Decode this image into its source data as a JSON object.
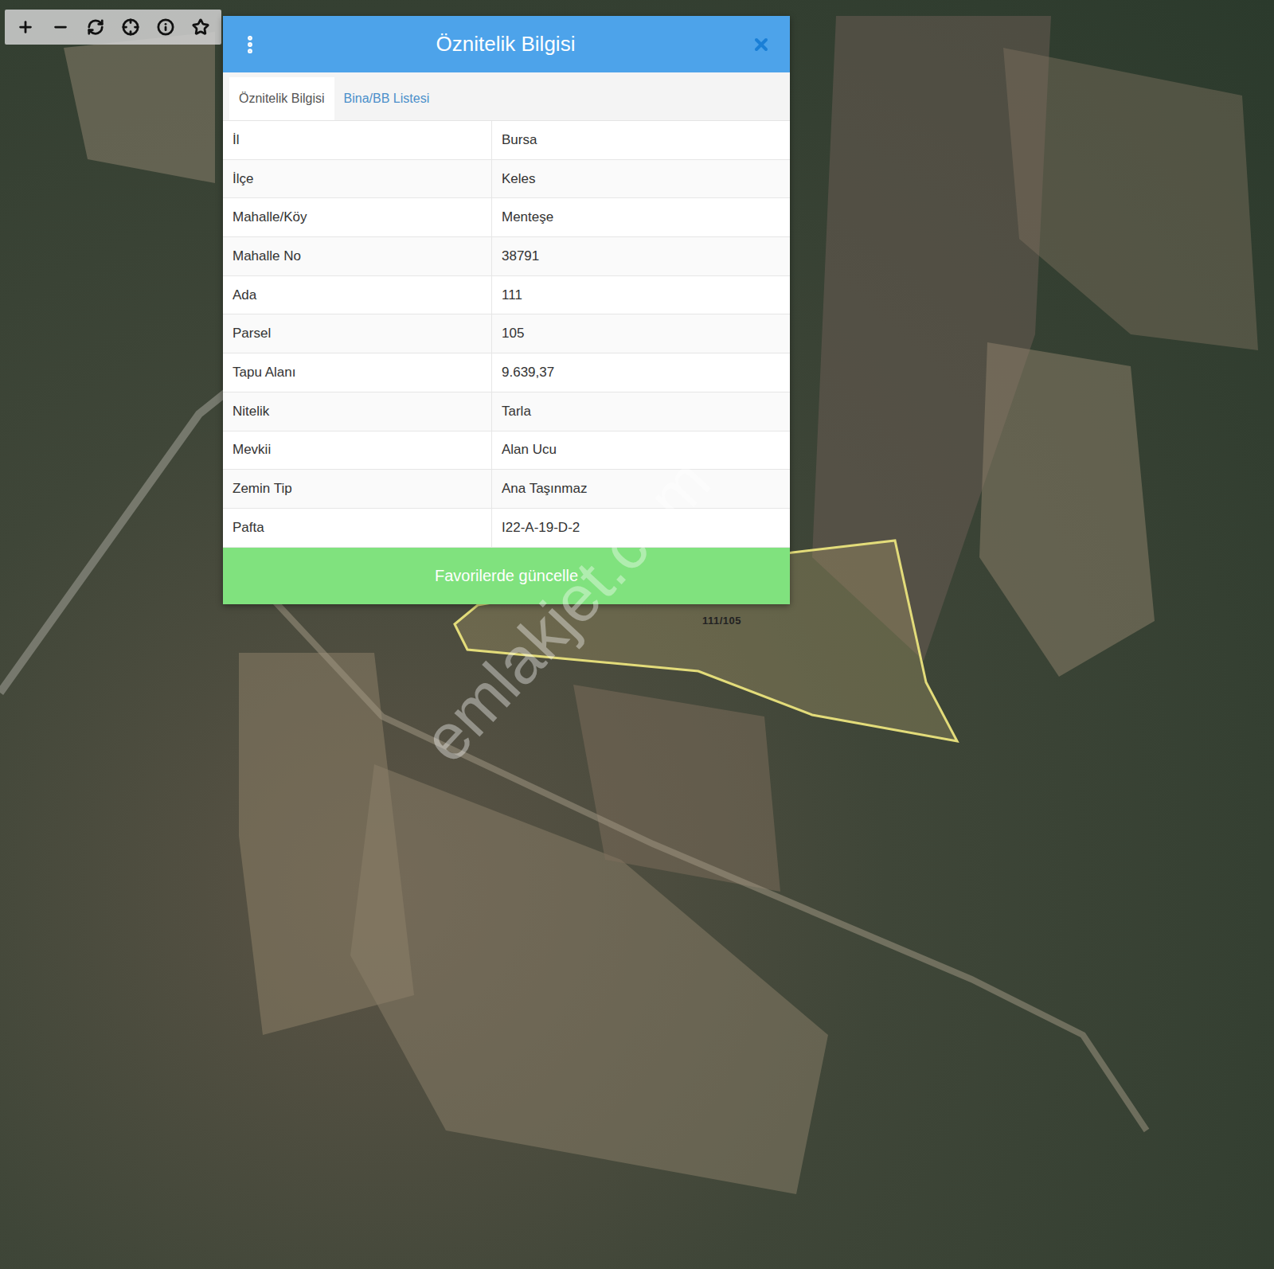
{
  "map": {
    "watermark": "emlakjet.com",
    "parcel": {
      "label": "111/105"
    }
  },
  "panel": {
    "title": "Öznitelik Bilgisi",
    "tabs": [
      {
        "label": "Öznitelik Bilgisi",
        "selected": true
      },
      {
        "label": "Bina/BB Listesi",
        "selected": false
      }
    ],
    "rows": [
      {
        "label": "İl",
        "value": "Bursa"
      },
      {
        "label": "İlçe",
        "value": "Keles"
      },
      {
        "label": "Mahalle/Köy",
        "value": "Menteşe"
      },
      {
        "label": "Mahalle No",
        "value": "38791"
      },
      {
        "label": "Ada",
        "value": "111"
      },
      {
        "label": "Parsel",
        "value": "105"
      },
      {
        "label": "Tapu Alanı",
        "value": "9.639,37"
      },
      {
        "label": "Nitelik",
        "value": "Tarla"
      },
      {
        "label": "Mevkii",
        "value": "Alan Ucu"
      },
      {
        "label": "Zemin Tip",
        "value": "Ana Taşınmaz"
      },
      {
        "label": "Pafta",
        "value": "I22-A-19-D-2"
      }
    ],
    "button": "Favorilerde güncelle"
  }
}
